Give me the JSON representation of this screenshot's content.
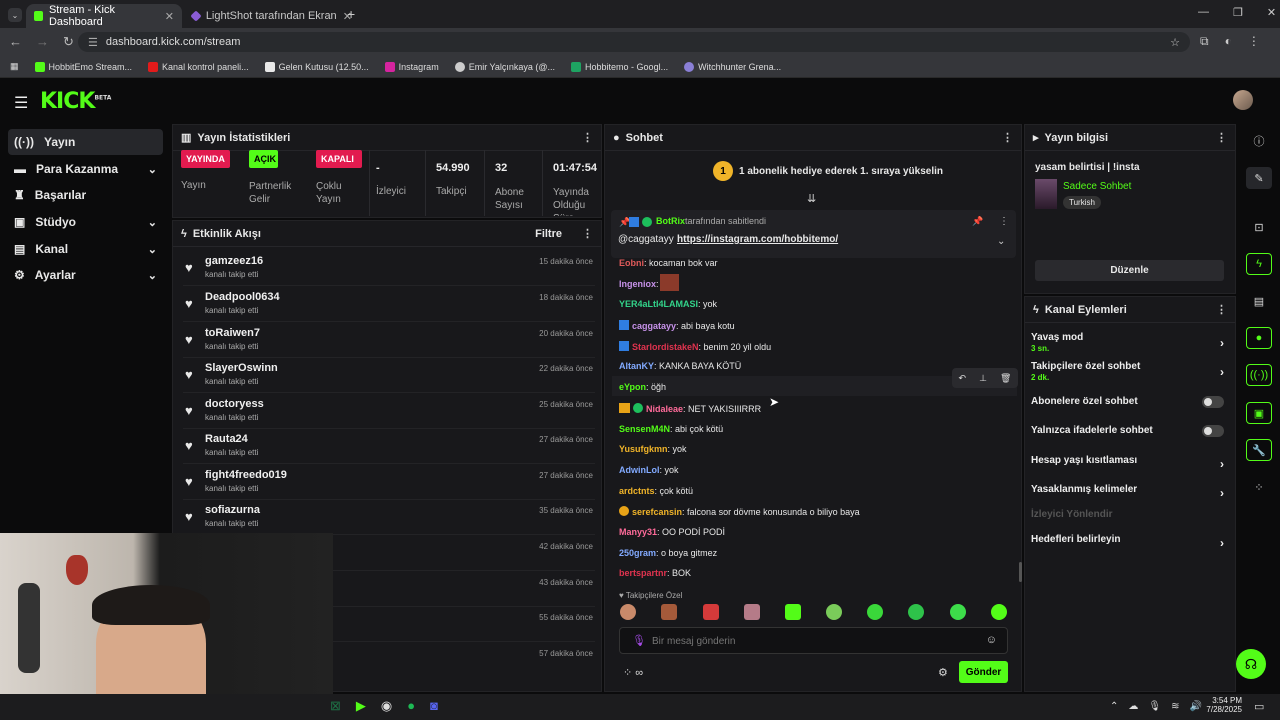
{
  "browser": {
    "tabs": [
      {
        "title": "Stream - Kick Dashboard"
      },
      {
        "title": "LightShot tarafından Ekran Gör"
      }
    ],
    "url": "dashboard.kick.com/stream",
    "bookmarks": [
      {
        "label": "HobbitEmo Stream...",
        "color": "#53fc18"
      },
      {
        "label": "Kanal kontrol paneli...",
        "color": "#e21b1b"
      },
      {
        "label": "Gelen Kutusu (12.50...",
        "color": "#e8e8e8"
      },
      {
        "label": "Instagram",
        "color": "#d6249f"
      },
      {
        "label": "Emir Yalçınkaya (@...",
        "color": "#cccccc"
      },
      {
        "label": "Hobbitemo - Googl...",
        "color": "#1ea362"
      },
      {
        "label": "Witchhunter Grena...",
        "color": "#8a7fd6"
      }
    ]
  },
  "app": {
    "logo": "KICK",
    "logo_sup": "BETA",
    "accent": "#53fc18"
  },
  "sidebar": {
    "items": [
      {
        "label": "Yayın",
        "icon": "broadcast-icon"
      },
      {
        "label": "Para Kazanma",
        "icon": "money-icon"
      },
      {
        "label": "Başarılar",
        "icon": "trophy-icon"
      },
      {
        "label": "Stüdyo",
        "icon": "studio-icon"
      },
      {
        "label": "Kanal",
        "icon": "channel-icon"
      },
      {
        "label": "Ayarlar",
        "icon": "gear-icon"
      }
    ]
  },
  "stats": {
    "title": "Yayın İstatistikleri",
    "items": [
      {
        "badge": "YAYINDA",
        "label": "Yayın",
        "badge_color": "#e21b4f"
      },
      {
        "badge": "AÇIK",
        "label": "Partnerlik Gelir",
        "badge_color": "#53fc18"
      },
      {
        "badge": "KAPALI",
        "label": "Çoklu Yayın",
        "badge_color": "#e21b4f"
      },
      {
        "value": "-",
        "label": "İzleyici"
      },
      {
        "value": "54.990",
        "label": "Takipçi"
      },
      {
        "value": "32",
        "label": "Abone Sayısı"
      },
      {
        "value": "01:47:54",
        "label": "Yayında Olduğu Süre"
      }
    ]
  },
  "activity": {
    "title": "Etkinlik Akışı",
    "filter": "Filtre",
    "items": [
      {
        "name": "gamzeez16",
        "sub": "kanalı takip etti",
        "time": "15 dakika önce"
      },
      {
        "name": "Deadpool0634",
        "sub": "kanalı takip etti",
        "time": "18 dakika önce"
      },
      {
        "name": "toRaiwen7",
        "sub": "kanalı takip etti",
        "time": "20 dakika önce"
      },
      {
        "name": "SlayerOswinn",
        "sub": "kanalı takip etti",
        "time": "22 dakika önce"
      },
      {
        "name": "doctoryess",
        "sub": "kanalı takip etti",
        "time": "25 dakika önce"
      },
      {
        "name": "Rauta24",
        "sub": "kanalı takip etti",
        "time": "27 dakika önce"
      },
      {
        "name": "fight4freedo019",
        "sub": "kanalı takip etti",
        "time": "27 dakika önce"
      },
      {
        "name": "sofiazurna",
        "sub": "kanalı takip etti",
        "time": "35 dakika önce"
      },
      {
        "name": "",
        "sub": "",
        "time": "42 dakika önce"
      },
      {
        "name": "",
        "sub": "",
        "time": "43 dakika önce"
      },
      {
        "name": "",
        "sub": "",
        "time": "55 dakika önce"
      },
      {
        "name": "",
        "sub": "",
        "time": "57 dakika önce"
      }
    ]
  },
  "chat": {
    "title": "Sohbet",
    "gift_banner": "1 abonelik hediye ederek 1. sıraya yükselin",
    "gift_count": "1",
    "pinned": {
      "by_user": "BotRix",
      "by_text": "tarafından sabitlendi",
      "mention": "@caggatayy",
      "link": "https://instagram.com/hobbitemo/"
    },
    "messages": [
      {
        "user": "Eobni",
        "color": "#e05a5a",
        "text": "kocaman bok var"
      },
      {
        "user": "Ingeniox",
        "color": "#c792ea",
        "text": ""
      },
      {
        "user": "YER4aLtI4LAMASI",
        "color": "#32d38a",
        "text": "yok"
      },
      {
        "user": "caggatayy",
        "color": "#c792ea",
        "text": "abi baya kotu"
      },
      {
        "user": "StarlordistakeN",
        "color": "#e0334f",
        "text": "benim 20 yil oldu"
      },
      {
        "user": "AltanKY",
        "color": "#82aaff",
        "text": "KANKA BAYA KÖTÜ"
      },
      {
        "user": "eYpon",
        "color": "#53fc18",
        "text": "öğh"
      },
      {
        "user": "Nidaleae",
        "color": "#ff6b9a",
        "text": "NET YAKISIIIRRR"
      },
      {
        "user": "SensenM4N",
        "color": "#53fc18",
        "text": "abi çok kötü"
      },
      {
        "user": "Yusufgkmn",
        "color": "#f0b429",
        "text": "yok"
      },
      {
        "user": "AdwinLol",
        "color": "#82aaff",
        "text": "yok"
      },
      {
        "user": "ardctnts",
        "color": "#f0b429",
        "text": "çok kötü"
      },
      {
        "user": "serefcansin",
        "color": "#f0b429",
        "text": "falcona sor dövme konusunda o biliyo baya"
      },
      {
        "user": "Manyy31",
        "color": "#ff6b9a",
        "text": "OO PODİ PODİ"
      },
      {
        "user": "250gram",
        "color": "#82aaff",
        "text": "o boya gitmez"
      },
      {
        "user": "bertspartnr",
        "color": "#e0334f",
        "text": "BOK"
      }
    ],
    "followers_only": "Takipçilere Özel",
    "input_placeholder": "Bir mesaj gönderin",
    "send": "Gönder"
  },
  "stream_info": {
    "title": "Yayın bilgisi",
    "stream_title": "yasam belirtisi | !insta",
    "category": "Sadece Sohbet",
    "language": "Turkish",
    "edit": "Düzenle"
  },
  "channel_actions": {
    "title": "Kanal Eylemleri",
    "items": [
      {
        "label": "Yavaş mod",
        "sub": "3 sn.",
        "control": "chevron"
      },
      {
        "label": "Takipçilere özel sohbet",
        "sub": "2 dk.",
        "control": "chevron"
      },
      {
        "label": "Abonelere özel sohbet",
        "sub": "",
        "control": "toggle"
      },
      {
        "label": "Yalnızca ifadelerle sohbet",
        "sub": "",
        "control": "toggle"
      },
      {
        "label": "Hesap yaşı kısıtlaması",
        "sub": "",
        "control": "chevron"
      },
      {
        "label": "Yasaklanmış kelimeler",
        "sub": "",
        "control": "chevron"
      },
      {
        "label": "İzleyici Yönlendir",
        "sub": "",
        "control": "disabled"
      },
      {
        "label": "Hedefleri belirleyin",
        "sub": "",
        "control": "chevron"
      }
    ]
  },
  "taskbar": {
    "time": "3:54 PM",
    "date": "7/28/2025"
  }
}
